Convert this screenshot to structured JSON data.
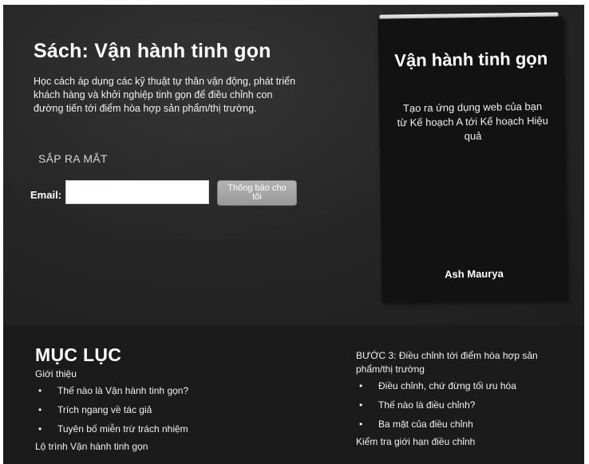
{
  "page": {
    "title": "Sách: Vận hành tinh gọn",
    "description": "Học cách áp dụng các kỹ thuật tự thân vận động, phát triển khách hàng và khởi nghiệp tinh gọn để điều chỉnh con đường tiến tới điểm hòa hợp sản phẩm/thị trường.",
    "coming_soon": "SẮP RA MẮT"
  },
  "signup": {
    "email_label": "Email:",
    "email_value": "",
    "notify_button": "Thông báo cho tôi"
  },
  "book": {
    "title": "Vận hành tinh gọn",
    "subtitle": "Tạo ra ứng dụng web của bạn từ Kế hoạch A tới Kế hoạch Hiệu quả",
    "author": "Ash Maurya"
  },
  "toc": {
    "heading": "MỤC LỤC",
    "left": {
      "section_title": "Giới thiệu",
      "items": [
        "Thế nào là Vận hành tinh gọn?",
        "Trích ngang về tác giả",
        "Tuyên bố miễn trừ trách nhiệm"
      ],
      "next_section": "Lộ trình Vận hành tinh gọn"
    },
    "right": {
      "section_title": "BƯỚC 3: Điều chỉnh tới điểm hòa hợp sản phẩm/thị trường",
      "items": [
        "Điều chỉnh, chứ đừng tối ưu hóa",
        "Thế nào là điều chỉnh?",
        "Ba mặt của điều chỉnh"
      ],
      "next_section": "Kiểm tra giới hạn điều chỉnh"
    },
    "bullet": "•"
  }
}
